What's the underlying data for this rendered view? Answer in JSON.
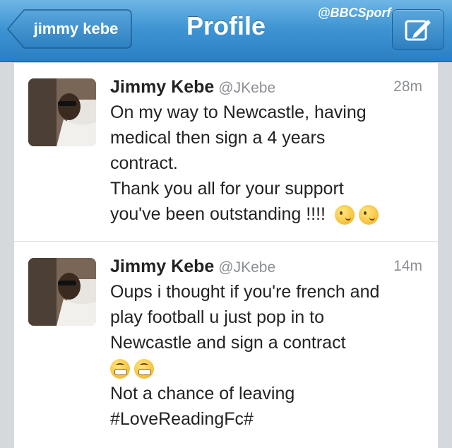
{
  "nav": {
    "back_label": "jimmy kebe",
    "title": "Profile",
    "watermark": "@BBCSporf",
    "compose_icon": "compose-icon"
  },
  "tweets": [
    {
      "name": "Jimmy Kebe",
      "handle": "@JKebe",
      "time": "28m",
      "lines": [
        "On my way to Newcastle, having",
        "medical then sign a 4 years",
        "contract.",
        "Thank you all for your support",
        "you've been outstanding !!!!"
      ],
      "emoji": [
        "wink-emoji",
        "wink-emoji"
      ]
    },
    {
      "name": "Jimmy Kebe",
      "handle": "@JKebe",
      "time": "14m",
      "lines": [
        "Oups i thought if you're french and",
        "play football u just pop in to",
        "Newcastle and sign a contract",
        "",
        "Not a chance of leaving",
        "#LoveReadingFc#"
      ],
      "emoji": [
        "grin-emoji",
        "grin-emoji"
      ]
    }
  ],
  "colors": {
    "nav_bar": "#3f95d3",
    "background": "#d5d9de",
    "muted_text": "#8c8f94"
  }
}
